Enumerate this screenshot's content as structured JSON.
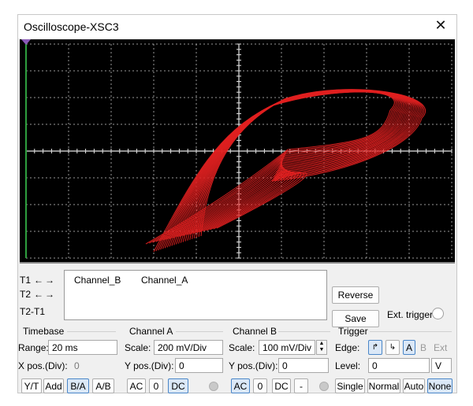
{
  "window": {
    "title": "Oscilloscope-XSC3",
    "close_glyph": "✕"
  },
  "screen": {
    "background": "#000000",
    "grid_color": "#bfbfbf",
    "trace_color": "#e02020",
    "marker_color": "#2e9e3e"
  },
  "cursors": {
    "t1": "T1",
    "t2": "T2",
    "t2t1": "T2-T1",
    "left_arrow": "←",
    "right_arrow": "→"
  },
  "readout": {
    "col1": "Channel_B",
    "col2": "Channel_A"
  },
  "buttons": {
    "reverse": "Reverse",
    "save": "Save"
  },
  "ext_trigger": "Ext. trigger",
  "timebase": {
    "title": "Timebase",
    "scale_label": "Range:",
    "scale_value": "20 ms",
    "xpos_label": "X pos.(Div):",
    "xpos_value": "0",
    "modes": [
      "Y/T",
      "Add",
      "B/A",
      "A/B"
    ],
    "selected_mode": "B/A"
  },
  "channel_a": {
    "title": "Channel A",
    "scale_label": "Scale:",
    "scale_value": "200 mV/Div",
    "ypos_label": "Y pos.(Div):",
    "ypos_value": "0",
    "coupling": [
      "AC",
      "0",
      "DC"
    ],
    "selected": "DC"
  },
  "channel_b": {
    "title": "Channel B",
    "scale_label": "Scale:",
    "scale_value": "100 mV/Div",
    "ypos_label": "Y pos.(Div):",
    "ypos_value": "0",
    "coupling": [
      "AC",
      "0",
      "DC",
      "-"
    ],
    "selected": "AC"
  },
  "trigger": {
    "title": "Trigger",
    "edge_label": "Edge:",
    "sources": [
      "A",
      "B",
      "Ext"
    ],
    "selected_source": "A",
    "level_label": "Level:",
    "level_value": "0",
    "level_unit": "V",
    "modes": [
      "Single",
      "Normal",
      "Auto",
      "None"
    ],
    "selected_mode": "None"
  }
}
